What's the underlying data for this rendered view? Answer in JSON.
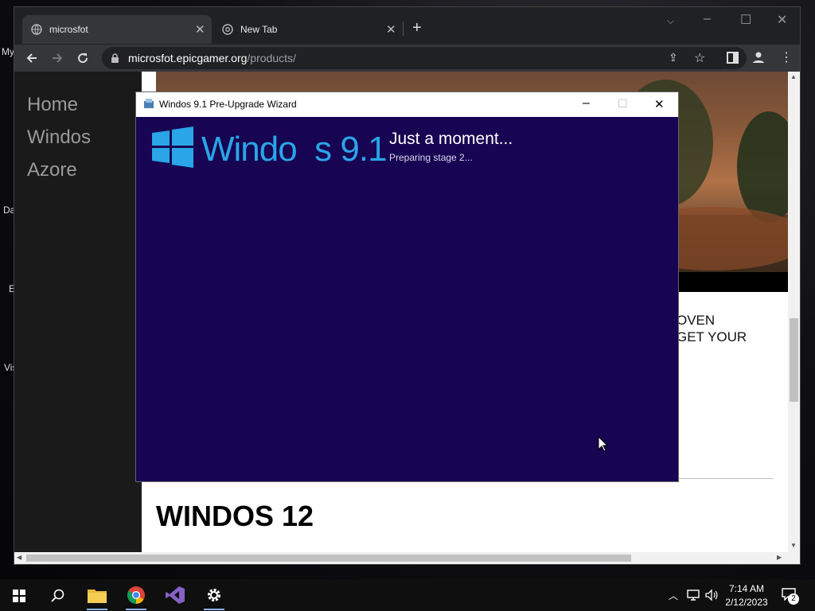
{
  "browser": {
    "tabs": [
      {
        "title": "microsfot",
        "active": true
      },
      {
        "title": "New Tab",
        "active": false
      }
    ],
    "url": {
      "host": "microsfot.epicgamer.org",
      "path": "/products/"
    }
  },
  "page": {
    "nav": [
      "Home",
      "Windos",
      "Azore"
    ],
    "promo": [
      "OVEN",
      "GET YOUR"
    ],
    "heading": "WINDOS 12"
  },
  "wizard": {
    "title": "Windos 9.1 Pre-Upgrade Wizard",
    "brand": "Windo  s 9.1",
    "heading": "Just a moment...",
    "status": "Preparing stage 2..."
  },
  "desktop": {
    "icon_label_fragments": [
      "My",
      "Da",
      "E",
      "Vis"
    ]
  },
  "taskbar": {
    "time": "7:14 AM",
    "date": "2/12/2023",
    "notification_count": "2"
  },
  "colors": {
    "wizard_background": "#170452",
    "brand_blue": "#2aa5e8",
    "browser_chrome": "#202124",
    "toolbar": "#35363a"
  }
}
